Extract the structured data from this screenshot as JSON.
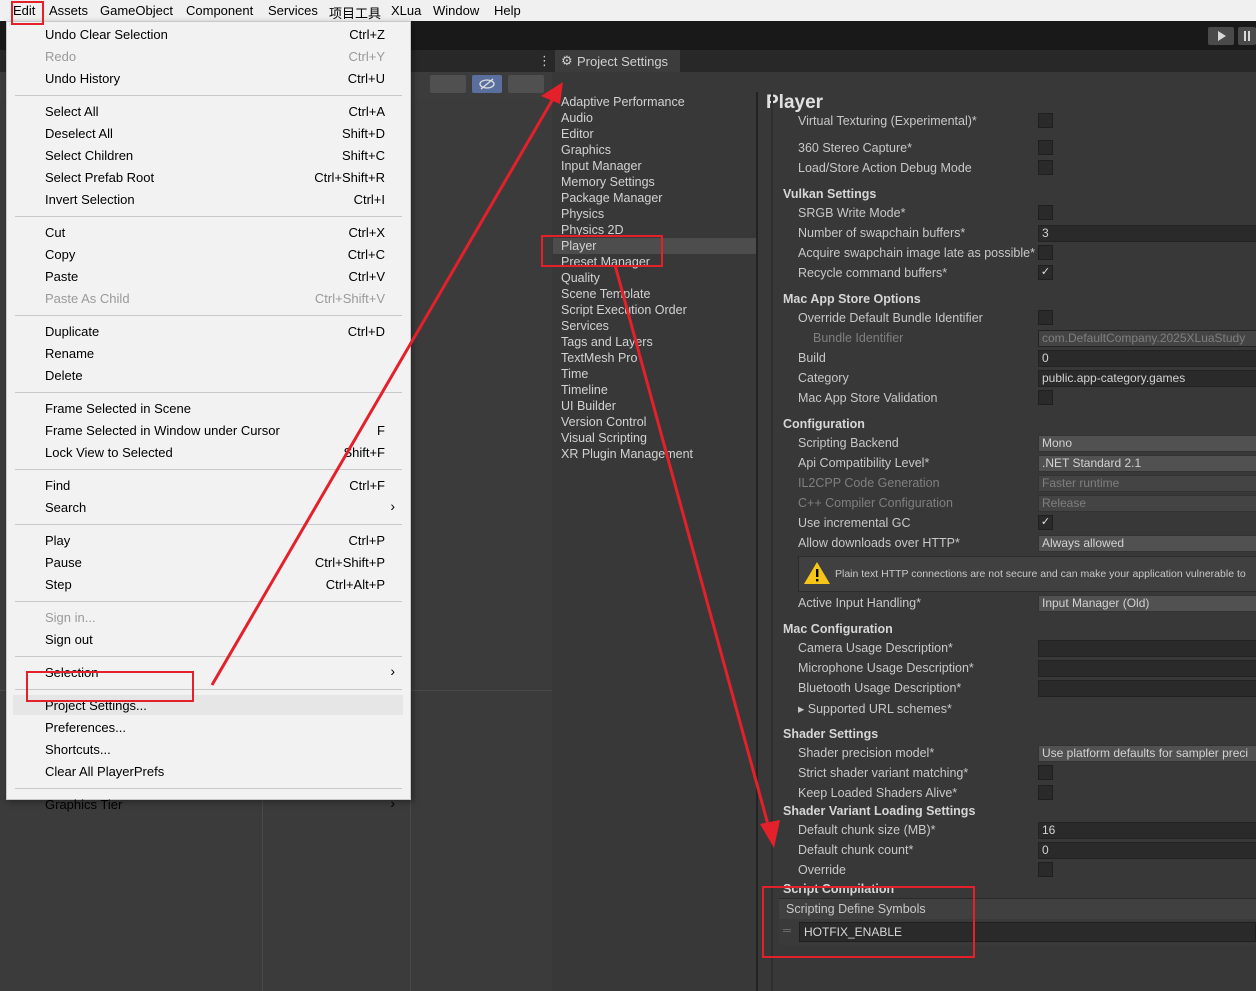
{
  "menubar": [
    "Edit",
    "Assets",
    "GameObject",
    "Component",
    "Services",
    "项目工具",
    "XLua",
    "Window",
    "Help"
  ],
  "edit_menu": {
    "groups": [
      [
        {
          "label": "Undo Clear Selection",
          "shortcut": "Ctrl+Z"
        },
        {
          "label": "Redo",
          "shortcut": "Ctrl+Y",
          "disabled": true
        },
        {
          "label": "Undo History",
          "shortcut": "Ctrl+U"
        }
      ],
      [
        {
          "label": "Select All",
          "shortcut": "Ctrl+A"
        },
        {
          "label": "Deselect All",
          "shortcut": "Shift+D"
        },
        {
          "label": "Select Children",
          "shortcut": "Shift+C"
        },
        {
          "label": "Select Prefab Root",
          "shortcut": "Ctrl+Shift+R"
        },
        {
          "label": "Invert Selection",
          "shortcut": "Ctrl+I"
        }
      ],
      [
        {
          "label": "Cut",
          "shortcut": "Ctrl+X"
        },
        {
          "label": "Copy",
          "shortcut": "Ctrl+C"
        },
        {
          "label": "Paste",
          "shortcut": "Ctrl+V"
        },
        {
          "label": "Paste As Child",
          "shortcut": "Ctrl+Shift+V",
          "disabled": true
        }
      ],
      [
        {
          "label": "Duplicate",
          "shortcut": "Ctrl+D"
        },
        {
          "label": "Rename",
          "shortcut": ""
        },
        {
          "label": "Delete",
          "shortcut": ""
        }
      ],
      [
        {
          "label": "Frame Selected in Scene",
          "shortcut": ""
        },
        {
          "label": "Frame Selected in Window under Cursor",
          "shortcut": "F"
        },
        {
          "label": "Lock View to Selected",
          "shortcut": "Shift+F"
        }
      ],
      [
        {
          "label": "Find",
          "shortcut": "Ctrl+F"
        },
        {
          "label": "Search",
          "shortcut": "",
          "submenu": true
        }
      ],
      [
        {
          "label": "Play",
          "shortcut": "Ctrl+P"
        },
        {
          "label": "Pause",
          "shortcut": "Ctrl+Shift+P"
        },
        {
          "label": "Step",
          "shortcut": "Ctrl+Alt+P"
        }
      ],
      [
        {
          "label": "Sign in...",
          "shortcut": "",
          "disabled": true
        },
        {
          "label": "Sign out",
          "shortcut": ""
        }
      ],
      [
        {
          "label": "Selection",
          "shortcut": "",
          "submenu": true
        }
      ],
      [
        {
          "label": "Project Settings...",
          "shortcut": "",
          "highlighted": true
        },
        {
          "label": "Preferences...",
          "shortcut": ""
        },
        {
          "label": "Shortcuts...",
          "shortcut": ""
        },
        {
          "label": "Clear All PlayerPrefs",
          "shortcut": ""
        }
      ],
      [
        {
          "label": "Graphics Tier",
          "shortcut": "",
          "submenu": true
        }
      ]
    ]
  },
  "project_settings": {
    "tab_title": "Project Settings",
    "categories": [
      "Adaptive Performance",
      "Audio",
      "Editor",
      "Graphics",
      "Input Manager",
      "Memory Settings",
      "Package Manager",
      "Physics",
      "Physics 2D",
      "Player",
      "Preset Manager",
      "Quality",
      "Scene Template",
      "Script Execution Order",
      "Services",
      "Tags and Layers",
      "TextMesh Pro",
      "Time",
      "Timeline",
      "UI Builder",
      "Version Control",
      "Visual Scripting",
      "XR Plugin Management"
    ],
    "selected_category": "Player",
    "panel_title": "Player",
    "rows": [
      {
        "kind": "label",
        "text": "Virtual Texturing (Experimental)*",
        "control": "check",
        "checked": false
      },
      {
        "kind": "label",
        "text": "360 Stereo Capture*",
        "control": "check",
        "checked": false
      },
      {
        "kind": "label",
        "text": "Load/Store Action Debug Mode",
        "control": "check",
        "checked": false
      },
      {
        "kind": "header",
        "text": "Vulkan Settings"
      },
      {
        "kind": "label",
        "text": "SRGB Write Mode*",
        "control": "check",
        "checked": false
      },
      {
        "kind": "label",
        "text": "Number of swapchain buffers*",
        "control": "field",
        "value": "3"
      },
      {
        "kind": "label",
        "text": "Acquire swapchain image late as possible*",
        "control": "check",
        "checked": false
      },
      {
        "kind": "label",
        "text": "Recycle command buffers*",
        "control": "check",
        "checked": true
      },
      {
        "kind": "header",
        "text": "Mac App Store Options"
      },
      {
        "kind": "label",
        "text": "Override Default Bundle Identifier",
        "control": "check",
        "checked": false
      },
      {
        "kind": "label",
        "text": "Bundle Identifier",
        "control": "field",
        "value": "com.DefaultCompany.2025XLuaStudy",
        "disabled": true,
        "indent": true
      },
      {
        "kind": "label",
        "text": "Build",
        "control": "field",
        "value": "0"
      },
      {
        "kind": "label",
        "text": "Category",
        "control": "field",
        "value": "public.app-category.games"
      },
      {
        "kind": "label",
        "text": "Mac App Store Validation",
        "control": "check",
        "checked": false
      },
      {
        "kind": "header",
        "text": "Configuration"
      },
      {
        "kind": "label",
        "text": "Scripting Backend",
        "control": "drop",
        "value": "Mono"
      },
      {
        "kind": "label",
        "text": "Api Compatibility Level*",
        "control": "drop",
        "value": ".NET Standard 2.1"
      },
      {
        "kind": "label",
        "text": "IL2CPP Code Generation",
        "control": "drop",
        "value": "Faster runtime",
        "disabled": true
      },
      {
        "kind": "label",
        "text": "C++ Compiler Configuration",
        "control": "drop",
        "value": "Release",
        "disabled": true
      },
      {
        "kind": "label",
        "text": "Use incremental GC",
        "control": "check",
        "checked": true
      },
      {
        "kind": "label",
        "text": "Allow downloads over HTTP*",
        "control": "drop",
        "value": "Always allowed"
      },
      {
        "kind": "warning",
        "text": "Plain text HTTP connections are not secure and can make your application vulnerable to"
      },
      {
        "kind": "label",
        "text": "Active Input Handling*",
        "control": "drop",
        "value": "Input Manager (Old)"
      },
      {
        "kind": "header",
        "text": "Mac Configuration"
      },
      {
        "kind": "label",
        "text": "Camera Usage Description*",
        "control": "field",
        "value": ""
      },
      {
        "kind": "label",
        "text": "Microphone Usage Description*",
        "control": "field",
        "value": ""
      },
      {
        "kind": "label",
        "text": "Bluetooth Usage Description*",
        "control": "field",
        "value": ""
      },
      {
        "kind": "label",
        "text": "▸ Supported URL schemes*",
        "control": "none"
      },
      {
        "kind": "header",
        "text": "Shader Settings"
      },
      {
        "kind": "label",
        "text": "Shader precision model*",
        "control": "drop",
        "value": "Use platform defaults for sampler preci"
      },
      {
        "kind": "label",
        "text": "Strict shader variant matching*",
        "control": "check",
        "checked": false
      },
      {
        "kind": "label",
        "text": "Keep Loaded Shaders Alive*",
        "control": "check",
        "checked": false
      },
      {
        "kind": "header",
        "text": "Shader Variant Loading Settings"
      },
      {
        "kind": "label",
        "text": "Default chunk size (MB)*",
        "control": "field",
        "value": "16"
      },
      {
        "kind": "label",
        "text": "Default chunk count*",
        "control": "field",
        "value": "0"
      },
      {
        "kind": "label",
        "text": "Override",
        "control": "check",
        "checked": false
      },
      {
        "kind": "header",
        "text": "Script Compilation"
      }
    ],
    "define_symbols_label": "Scripting Define Symbols",
    "define_symbols_value": "HOTFIX_ENABLE"
  },
  "colors": {
    "highlight": "#e4202a",
    "menu_bg": "#f2f2f2",
    "editor_bg": "#383838"
  }
}
